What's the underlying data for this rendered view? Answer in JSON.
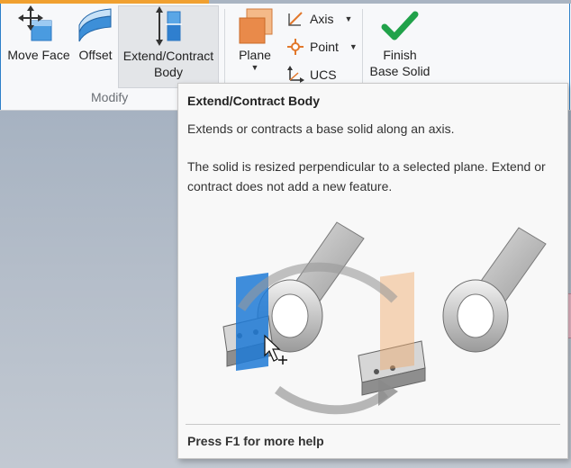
{
  "ribbon": {
    "modify_tools": [
      {
        "id": "move-face",
        "label": "Move Face"
      },
      {
        "id": "offset",
        "label": "Offset"
      },
      {
        "id": "extend-contract-body",
        "label_line1": "Extend/Contract",
        "label_line2": "Body",
        "selected": true
      }
    ],
    "modify_group_label": "Modify",
    "plane": {
      "label": "Plane"
    },
    "axis": {
      "label": "Axis"
    },
    "point": {
      "label": "Point"
    },
    "ucs": {
      "label": "UCS"
    },
    "finish": {
      "label_line1": "Finish",
      "label_line2": "Base Solid"
    }
  },
  "tooltip": {
    "title": "Extend/Contract Body",
    "description": "Extends or contracts a base solid along an axis.",
    "detail": "The solid is resized perpendicular to a selected plane. Extend or contract does not add a new feature.",
    "help": "Press F1 for more help"
  },
  "colors": {
    "accent_blue": "#2c7fc9",
    "plane_blue": "#1f7ad6",
    "plane_orange": "#f0a868",
    "finish_green": "#21a24a"
  },
  "icons": [
    "move-face-icon",
    "offset-icon",
    "extend-contract-icon",
    "plane-icon",
    "axis-icon",
    "point-icon",
    "ucs-icon",
    "checkmark-icon",
    "cursor-icon"
  ]
}
